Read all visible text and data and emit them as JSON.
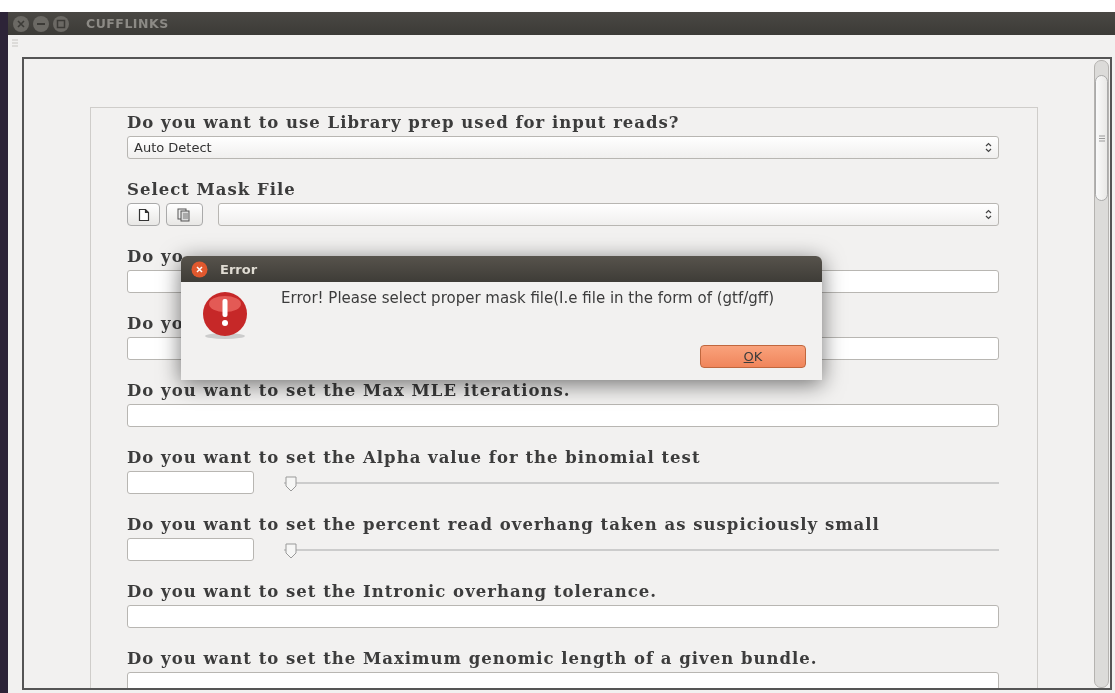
{
  "window": {
    "title": "CUFFLINKS"
  },
  "form": {
    "fields": [
      {
        "kind": "select",
        "label": "Do you want to use Library prep used for input reads?",
        "value": "Auto Detect"
      },
      {
        "kind": "file",
        "label": "Select Mask File"
      },
      {
        "kind": "text",
        "label": "Do yo"
      },
      {
        "kind": "text",
        "label": "Do yo"
      },
      {
        "kind": "text",
        "label": "Do you want to set the Max MLE iterations."
      },
      {
        "kind": "slider",
        "label": "Do you want to set the Alpha value for the binomial test",
        "level": 0
      },
      {
        "kind": "slider",
        "label": "Do you want to set the percent read overhang taken as suspiciously small",
        "level": 0
      },
      {
        "kind": "text",
        "label": "Do you want to set the Intronic overhang tolerance."
      },
      {
        "kind": "text",
        "label": "Do you want to set the Maximum genomic length of a given bundle."
      }
    ]
  },
  "dialog": {
    "title": "Error",
    "message": "Error! Please select proper mask file(I.e file in the form of (gtf/gff)",
    "buttons": [
      "OK"
    ]
  }
}
